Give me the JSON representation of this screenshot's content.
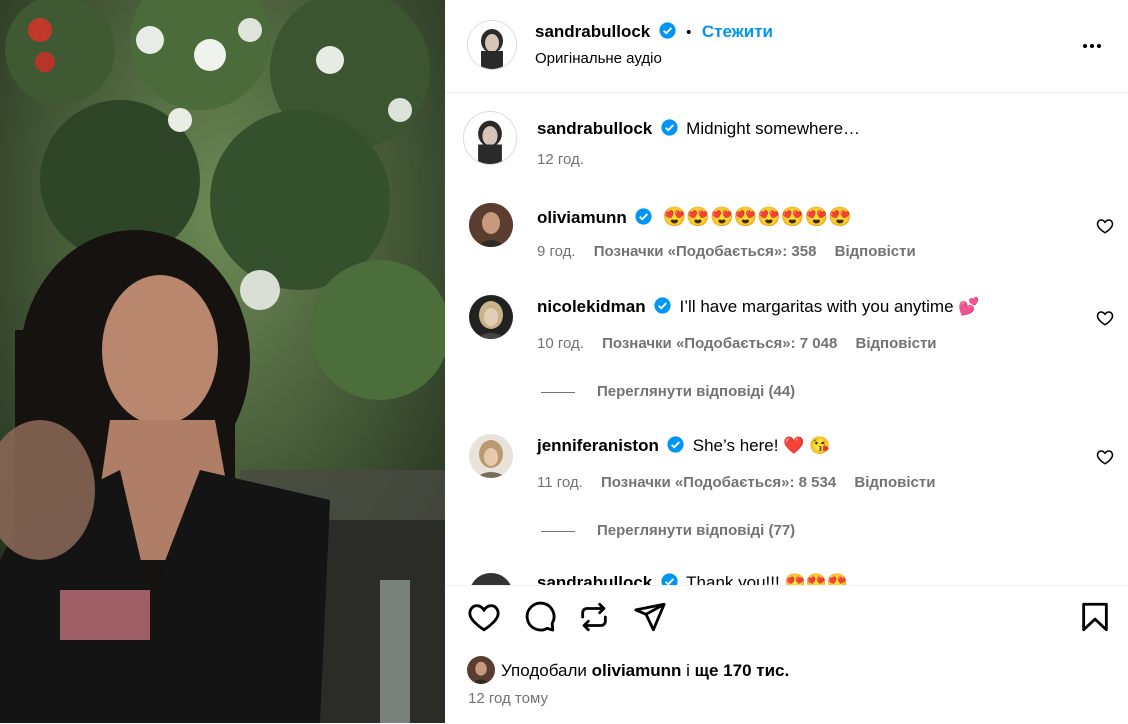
{
  "post": {
    "author": "sandrabullock",
    "follow_label": "Стежити",
    "bullet": "•",
    "audio": "Оригінальне аудіо",
    "caption": "Midnight somewhere…",
    "caption_time": "12 год."
  },
  "comments": [
    {
      "user": "oliviamunn",
      "text": "😍😍😍😍😍😍😍😍",
      "time": "9 год.",
      "likes": "Позначки «Подобається»: 358",
      "reply": "Відповісти",
      "avatar_color": "#6b4a3a"
    },
    {
      "user": "nicolekidman",
      "text": "I’ll have margaritas with you anytime 💕",
      "time": "10 год.",
      "likes": "Позначки «Подобається»: 7 048",
      "reply": "Відповісти",
      "view_replies": "Переглянути відповіді (44)",
      "avatar_color": "#c9b48a"
    },
    {
      "user": "jenniferaniston",
      "text": "She’s here! ❤️ 😘",
      "time": "11 год.",
      "likes": "Позначки «Подобається»: 8 534",
      "reply": "Відповісти",
      "view_replies": "Переглянути відповіді (77)",
      "avatar_color": "#b89a6e"
    },
    {
      "user": "sandrabullock",
      "text": "Thank you!!! 😍😍😍",
      "avatar_color": "#333333"
    }
  ],
  "footer": {
    "liked_prefix": "Уподобали",
    "liked_user": "oliviamunn",
    "liked_joiner": "і",
    "liked_suffix": "ще 170 тис.",
    "timestamp": "12 год тому"
  },
  "icons": {
    "like": "heart-icon",
    "comment": "comment-icon",
    "repost": "repost-icon",
    "share": "share-icon",
    "save": "bookmark-icon",
    "more": "more-icon",
    "verified": "verified-badge-icon"
  },
  "colors": {
    "accent": "#0095f6",
    "muted": "#737373",
    "verified": "#0095f6"
  }
}
